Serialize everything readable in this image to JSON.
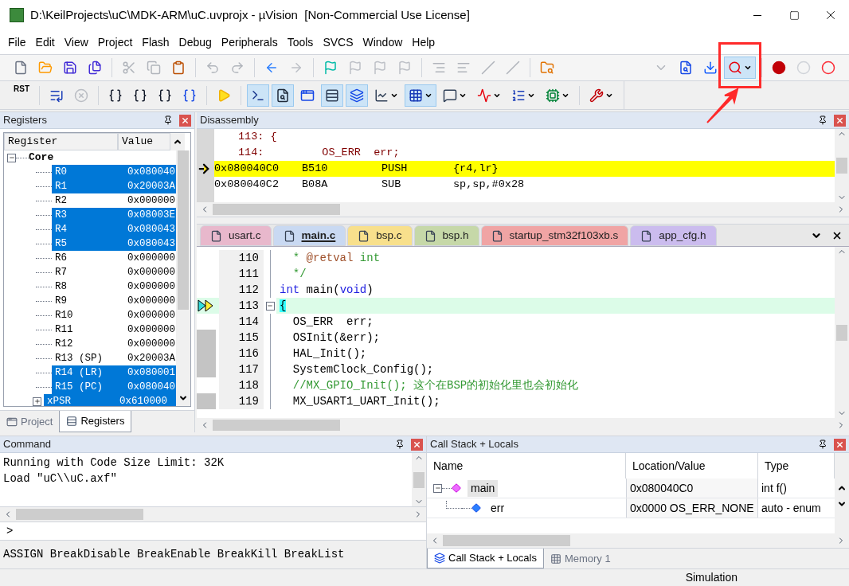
{
  "window": {
    "title": "D:\\KeilProjects\\uC\\MDK-ARM\\uC.uvprojx - µVision  [Non-Commercial Use License]"
  },
  "menu": [
    "File",
    "Edit",
    "View",
    "Project",
    "Flash",
    "Debug",
    "Peripherals",
    "Tools",
    "SVCS",
    "Window",
    "Help"
  ],
  "toolbar_file": [
    {
      "kind": "new",
      "disabled": false,
      "selected": false,
      "dropdown": false
    },
    {
      "kind": "open",
      "disabled": false,
      "selected": false,
      "dropdown": false
    },
    {
      "kind": "save",
      "disabled": false,
      "selected": false,
      "dropdown": false
    },
    {
      "kind": "save-all",
      "disabled": false,
      "selected": false,
      "dropdown": false
    },
    {
      "kind": "separator"
    },
    {
      "kind": "cut",
      "disabled": true,
      "selected": false,
      "dropdown": false
    },
    {
      "kind": "copy",
      "disabled": true,
      "selected": false,
      "dropdown": false
    },
    {
      "kind": "paste",
      "disabled": false,
      "selected": false,
      "dropdown": false
    },
    {
      "kind": "separator"
    },
    {
      "kind": "undo",
      "disabled": true,
      "selected": false,
      "dropdown": false
    },
    {
      "kind": "redo",
      "disabled": true,
      "selected": false,
      "dropdown": false
    },
    {
      "kind": "separator"
    },
    {
      "kind": "back",
      "disabled": false,
      "selected": false,
      "dropdown": false
    },
    {
      "kind": "forward",
      "disabled": true,
      "selected": false,
      "dropdown": false
    },
    {
      "kind": "separator"
    },
    {
      "kind": "bookmark",
      "disabled": false,
      "selected": false,
      "dropdown": false
    },
    {
      "kind": "bookmark-prev",
      "disabled": true,
      "selected": false,
      "dropdown": false
    },
    {
      "kind": "bookmark-next",
      "disabled": true,
      "selected": false,
      "dropdown": false
    },
    {
      "kind": "bookmark-clear",
      "disabled": true,
      "selected": false,
      "dropdown": false
    },
    {
      "kind": "separator"
    },
    {
      "kind": "indent",
      "disabled": true,
      "selected": false,
      "dropdown": false
    },
    {
      "kind": "unindent",
      "disabled": true,
      "selected": false,
      "dropdown": false
    },
    {
      "kind": "comment",
      "disabled": true,
      "selected": false,
      "dropdown": false
    },
    {
      "kind": "uncomment",
      "disabled": true,
      "selected": false,
      "dropdown": false
    },
    {
      "kind": "separator"
    },
    {
      "kind": "find-in-files",
      "disabled": false,
      "selected": false,
      "dropdown": false
    },
    {
      "kind": "spacer"
    },
    {
      "kind": "combo",
      "disabled": true,
      "selected": false,
      "dropdown": false
    },
    {
      "kind": "find",
      "disabled": false,
      "selected": false,
      "dropdown": false
    },
    {
      "kind": "load",
      "disabled": false,
      "selected": false,
      "dropdown": false
    },
    {
      "kind": "debug",
      "disabled": false,
      "selected": true,
      "dropdown": true
    },
    {
      "kind": "separator"
    },
    {
      "kind": "breakpoint",
      "disabled": false,
      "selected": false,
      "dropdown": false
    },
    {
      "kind": "breakpoint-disable",
      "disabled": true,
      "selected": false,
      "dropdown": false
    },
    {
      "kind": "breakpoint-kill",
      "disabled": false,
      "selected": false,
      "dropdown": false
    }
  ],
  "toolbar_debug": [
    {
      "kind": "reset",
      "label": "RST",
      "disabled": false,
      "selected": false,
      "dropdown": false
    },
    {
      "kind": "separator"
    },
    {
      "kind": "run",
      "disabled": false,
      "selected": false,
      "dropdown": false
    },
    {
      "kind": "stop",
      "disabled": true,
      "selected": false,
      "dropdown": false
    },
    {
      "kind": "separator"
    },
    {
      "kind": "step-in",
      "disabled": false,
      "selected": false,
      "dropdown": false
    },
    {
      "kind": "step-over",
      "disabled": false,
      "selected": false,
      "dropdown": false
    },
    {
      "kind": "step-out",
      "disabled": false,
      "selected": false,
      "dropdown": false
    },
    {
      "kind": "run-to-cursor",
      "disabled": false,
      "selected": false,
      "dropdown": false
    },
    {
      "kind": "separator"
    },
    {
      "kind": "show-next",
      "disabled": false,
      "selected": false,
      "dropdown": false
    },
    {
      "kind": "separator"
    },
    {
      "kind": "command-window",
      "disabled": false,
      "selected": true,
      "dropdown": false
    },
    {
      "kind": "disassembly-window",
      "disabled": false,
      "selected": true,
      "dropdown": false
    },
    {
      "kind": "symbols-window",
      "disabled": false,
      "selected": false,
      "dropdown": false
    },
    {
      "kind": "registers-window",
      "disabled": false,
      "selected": true,
      "dropdown": false
    },
    {
      "kind": "call-stack-window",
      "disabled": false,
      "selected": true,
      "dropdown": false
    },
    {
      "kind": "watch-window",
      "disabled": false,
      "selected": false,
      "dropdown": true
    },
    {
      "kind": "memory-window",
      "disabled": false,
      "selected": true,
      "dropdown": true
    },
    {
      "kind": "serial-window",
      "disabled": false,
      "selected": false,
      "dropdown": true
    },
    {
      "kind": "analysis-window",
      "disabled": false,
      "selected": false,
      "dropdown": true
    },
    {
      "kind": "trace-window",
      "disabled": false,
      "selected": false,
      "dropdown": true
    },
    {
      "kind": "system-viewer",
      "disabled": false,
      "selected": false,
      "dropdown": true
    },
    {
      "kind": "separator"
    },
    {
      "kind": "toolbox",
      "disabled": false,
      "selected": false,
      "dropdown": true
    }
  ],
  "registers": {
    "title": "Registers",
    "columns": [
      "Register",
      "Value"
    ],
    "groups": [
      {
        "name": "Core",
        "expanded": true,
        "children": [
          {
            "name": "R0",
            "value": "0x080040",
            "selected": true,
            "kind": "register"
          },
          {
            "name": "R1",
            "value": "0x20003A",
            "selected": true,
            "kind": "register"
          },
          {
            "name": "R2",
            "value": "0x000000",
            "selected": false,
            "kind": "register"
          },
          {
            "name": "R3",
            "value": "0x08003E",
            "selected": true,
            "kind": "register"
          },
          {
            "name": "R4",
            "value": "0x080043",
            "selected": true,
            "kind": "register"
          },
          {
            "name": "R5",
            "value": "0x080043",
            "selected": true,
            "kind": "register"
          },
          {
            "name": "R6",
            "value": "0x000000",
            "selected": false,
            "kind": "register"
          },
          {
            "name": "R7",
            "value": "0x000000",
            "selected": false,
            "kind": "register"
          },
          {
            "name": "R8",
            "value": "0x000000",
            "selected": false,
            "kind": "register"
          },
          {
            "name": "R9",
            "value": "0x000000",
            "selected": false,
            "kind": "register"
          },
          {
            "name": "R10",
            "value": "0x000000",
            "selected": false,
            "kind": "register"
          },
          {
            "name": "R11",
            "value": "0x000000",
            "selected": false,
            "kind": "register"
          },
          {
            "name": "R12",
            "value": "0x000000",
            "selected": false,
            "kind": "register"
          },
          {
            "name": "R13 (SP)",
            "value": "0x20003A",
            "selected": false,
            "kind": "register"
          },
          {
            "name": "R14 (LR)",
            "value": "0x080001",
            "selected": true,
            "kind": "register"
          },
          {
            "name": "R15 (PC)",
            "value": "0x080040",
            "selected": true,
            "kind": "register"
          },
          {
            "name": "xPSR",
            "value": "0x610000",
            "selected": true,
            "kind": "collapsed-group"
          }
        ]
      }
    ]
  },
  "left_tabs": [
    {
      "label": "Project",
      "selected": false,
      "kind": "project"
    },
    {
      "label": "Registers",
      "selected": true,
      "kind": "registers"
    }
  ],
  "disassembly": {
    "title": "Disassembly",
    "lines": [
      {
        "kind": "source",
        "text": "113: {",
        "current": false
      },
      {
        "kind": "source",
        "text": "114:         OS_ERR  err;",
        "current": false
      },
      {
        "kind": "asm",
        "address": "0x080040C0",
        "opcode": "B510",
        "mnemonic": "PUSH",
        "operands": "{r4,lr}",
        "current": true
      },
      {
        "kind": "asm",
        "address": "0x080040C2",
        "opcode": "B08A",
        "mnemonic": "SUB",
        "operands": "sp,sp,#0x28",
        "current": false
      }
    ]
  },
  "editor_tabs": [
    {
      "label": "usart.c",
      "color": "#e8b8cc",
      "selected": false
    },
    {
      "label": "main.c",
      "color": "#c9d9f2",
      "selected": true
    },
    {
      "label": "bsp.c",
      "color": "#f8e08c",
      "selected": false
    },
    {
      "label": "bsp.h",
      "color": "#c6d8a8",
      "selected": false
    },
    {
      "label": "startup_stm32f103xb.s",
      "color": "#f0a4a4",
      "selected": false
    },
    {
      "label": "app_cfg.h",
      "color": "#cbbcee",
      "selected": false
    }
  ],
  "code": [
    {
      "number": "110",
      "current": false,
      "marked": false,
      "foldable": false,
      "segments": [
        {
          "kind": "comment",
          "text": "  * "
        },
        {
          "kind": "tag",
          "text": "@retval"
        },
        {
          "kind": "comment",
          "text": " int"
        }
      ]
    },
    {
      "number": "111",
      "current": false,
      "marked": false,
      "foldable": false,
      "segments": [
        {
          "kind": "comment",
          "text": "  */"
        }
      ]
    },
    {
      "number": "112",
      "current": false,
      "marked": false,
      "foldable": false,
      "segments": [
        {
          "kind": "keyword",
          "text": "int"
        },
        {
          "kind": "plain",
          "text": " main("
        },
        {
          "kind": "keyword",
          "text": "void"
        },
        {
          "kind": "plain",
          "text": ")"
        }
      ]
    },
    {
      "number": "113",
      "current": true,
      "marked": false,
      "foldable": true,
      "segments": [
        {
          "kind": "brace",
          "text": "{"
        }
      ]
    },
    {
      "number": "114",
      "current": false,
      "marked": false,
      "foldable": false,
      "segments": [
        {
          "kind": "plain",
          "text": "  OS_ERR  err;"
        }
      ]
    },
    {
      "number": "115",
      "current": false,
      "marked": true,
      "foldable": false,
      "segments": [
        {
          "kind": "plain",
          "text": "  OSInit(&err);"
        }
      ]
    },
    {
      "number": "116",
      "current": false,
      "marked": true,
      "foldable": false,
      "segments": [
        {
          "kind": "plain",
          "text": "  HAL_Init();"
        }
      ]
    },
    {
      "number": "117",
      "current": false,
      "marked": true,
      "foldable": false,
      "segments": [
        {
          "kind": "plain",
          "text": "  SystemClock_Config();"
        }
      ]
    },
    {
      "number": "118",
      "current": false,
      "marked": false,
      "foldable": false,
      "segments": [
        {
          "kind": "comment",
          "text": "  //MX_GPIO_Init(); 这个在BSP的初始化里也会初始化"
        }
      ]
    },
    {
      "number": "119",
      "current": false,
      "marked": true,
      "foldable": false,
      "segments": [
        {
          "kind": "plain",
          "text": "  MX_USART1_UART_Init();"
        }
      ]
    }
  ],
  "command": {
    "title": "Command",
    "output": [
      "Running with Code Size Limit: 32K",
      "Load \"uC\\\\uC.axf\""
    ],
    "prompt": ">",
    "hint": "ASSIGN BreakDisable BreakEnable BreakKill BreakList"
  },
  "call_stack": {
    "title": "Call Stack + Locals",
    "columns": [
      "Name",
      "Location/Value",
      "Type"
    ],
    "rows": [
      {
        "name": "main",
        "value": "0x080040C0",
        "type": "int f()",
        "kind": "function",
        "expanded": true,
        "children": [
          {
            "name": "err",
            "value": "0x0000 OS_ERR_NONE",
            "type": "auto - enum",
            "kind": "variable"
          }
        ]
      }
    ]
  },
  "bottom_tabs": [
    {
      "label": "Call Stack + Locals",
      "selected": true,
      "kind": "call-stack"
    },
    {
      "label": "Memory 1",
      "selected": false,
      "kind": "memory"
    }
  ],
  "status_bar": {
    "mode": "Simulation"
  }
}
